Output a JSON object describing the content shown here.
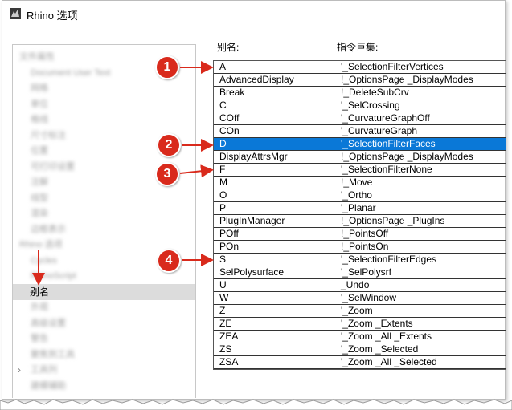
{
  "window": {
    "title": "Rhino 选项"
  },
  "tree": {
    "items": [
      {
        "label": "文件属性",
        "blurred": true
      },
      {
        "label": "Document User Text",
        "blurred": true
      },
      {
        "label": "网格",
        "blurred": true
      },
      {
        "label": "单位",
        "blurred": true
      },
      {
        "label": "格线",
        "blurred": true
      },
      {
        "label": "尺寸标注",
        "blurred": true
      },
      {
        "label": "位置",
        "blurred": true
      },
      {
        "label": "可打印设置",
        "blurred": true
      },
      {
        "label": "注解",
        "blurred": true
      },
      {
        "label": "线型",
        "blurred": true
      },
      {
        "label": "渲染",
        "blurred": true
      },
      {
        "label": "边框表示",
        "blurred": true
      },
      {
        "label": "Rhino 选项",
        "blurred": true
      },
      {
        "label": "Cycles",
        "blurred": true
      },
      {
        "label": "RhinoScript",
        "blurred": true
      },
      {
        "label": "别名",
        "blurred": false,
        "selected": true
      },
      {
        "label": "外观",
        "blurred": true
      },
      {
        "label": "高级设置",
        "blurred": true
      },
      {
        "label": "警告",
        "blurred": true
      },
      {
        "label": "聚焦到工具",
        "blurred": true
      },
      {
        "label": "工具列",
        "blurred": true
      },
      {
        "label": "建模辅助",
        "blurred": true
      }
    ]
  },
  "headers": {
    "alias": "别名:",
    "macro": "指令巨集:"
  },
  "aliases": [
    {
      "name": "A",
      "macro": "'_SelectionFilterVertices"
    },
    {
      "name": "AdvancedDisplay",
      "macro": "!_OptionsPage _DisplayModes"
    },
    {
      "name": "Break",
      "macro": "!_DeleteSubCrv"
    },
    {
      "name": "C",
      "macro": "'_SelCrossing"
    },
    {
      "name": "COff",
      "macro": "'_CurvatureGraphOff"
    },
    {
      "name": "COn",
      "macro": "'_CurvatureGraph"
    },
    {
      "name": "D",
      "macro": "'_SelectionFilterFaces",
      "selected": true
    },
    {
      "name": "DisplayAttrsMgr",
      "macro": "!_OptionsPage _DisplayModes"
    },
    {
      "name": "F",
      "macro": "'_SelectionFilterNone"
    },
    {
      "name": "M",
      "macro": "!_Move"
    },
    {
      "name": "O",
      "macro": "'_Ortho"
    },
    {
      "name": "P",
      "macro": "'_Planar"
    },
    {
      "name": "PlugInManager",
      "macro": "!_OptionsPage _PlugIns"
    },
    {
      "name": "POff",
      "macro": "!_PointsOff"
    },
    {
      "name": "POn",
      "macro": "!_PointsOn"
    },
    {
      "name": "S",
      "macro": "'_SelectionFilterEdges"
    },
    {
      "name": "SelPolysurface",
      "macro": "'_SelPolysrf"
    },
    {
      "name": "U",
      "macro": "_Undo"
    },
    {
      "name": "W",
      "macro": "'_SelWindow"
    },
    {
      "name": "Z",
      "macro": "'_Zoom"
    },
    {
      "name": "ZE",
      "macro": "'_Zoom _Extents"
    },
    {
      "name": "ZEA",
      "macro": "'_Zoom _All _Extents"
    },
    {
      "name": "ZS",
      "macro": "'_Zoom _Selected"
    },
    {
      "name": "ZSA",
      "macro": "'_Zoom _All _Selected"
    }
  ],
  "callouts": [
    "1",
    "2",
    "3",
    "4"
  ],
  "colors": {
    "callout": "#d92a1c",
    "selection": "#0a78d7"
  }
}
